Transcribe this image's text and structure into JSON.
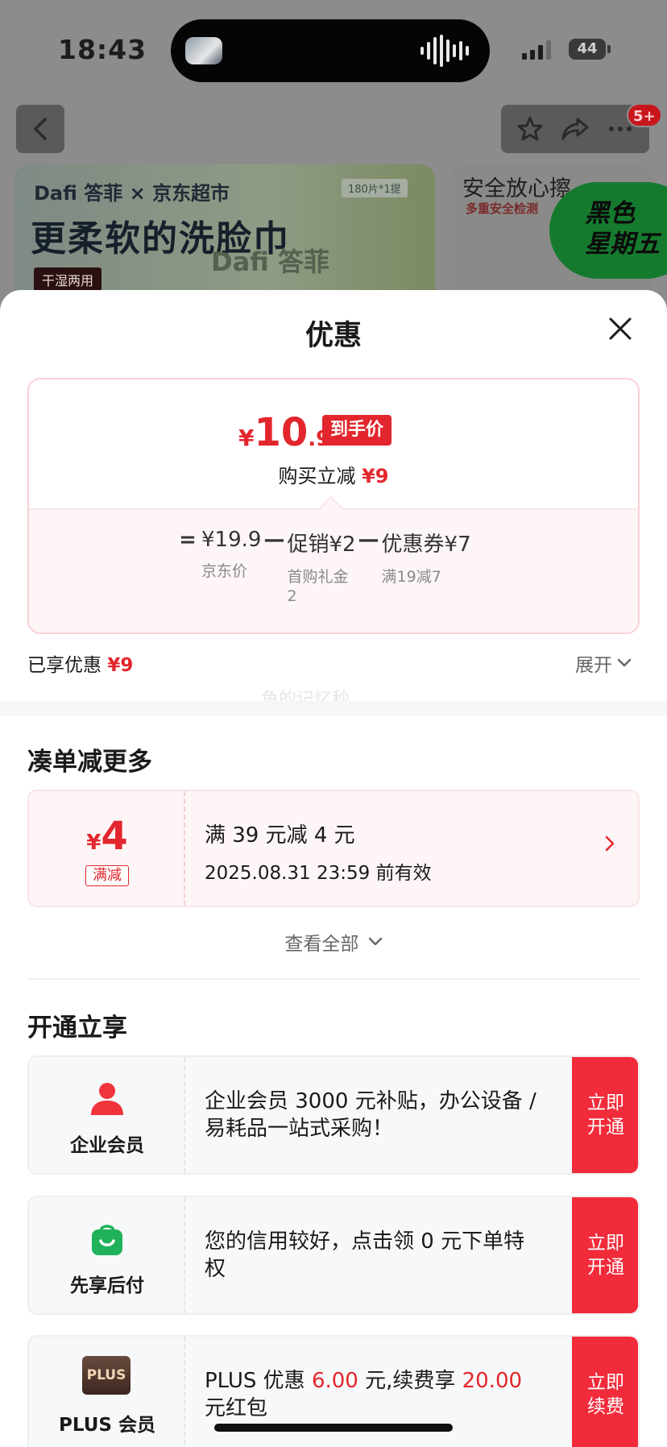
{
  "status_bar": {
    "time": "18:43",
    "battery": "44"
  },
  "background": {
    "badge": "5+",
    "banner_left": {
      "brand": "Dafi 答菲 × 京东超市",
      "title": "更柔软的洗脸巾",
      "tag": "干湿两用",
      "pack_chip": "180片*1提",
      "pack_brand": "Dafi 答菲"
    },
    "banner_right": {
      "title": "安全放心擦",
      "subtitle": "多重安全检测",
      "promo": "黑色\n星期五"
    }
  },
  "sheet": {
    "title": "优惠",
    "price_card": {
      "currency": "¥",
      "price_int": "10",
      "price_dec": ".9",
      "price_tag": "到手价",
      "instant_label": "购买立减",
      "instant_amount": "¥9",
      "formula": {
        "eq": "=",
        "minus": "—",
        "items": [
          {
            "value": "¥19.9",
            "label": "京东价"
          },
          {
            "value": "促销¥2",
            "label": "首购礼金\n2"
          },
          {
            "value": "优惠券¥7",
            "label": "满19减7"
          }
        ]
      }
    },
    "enjoyed": {
      "label": "已享优惠",
      "amount": "¥9"
    },
    "expand_label": "展开",
    "watermark": "鱼的记忆秒",
    "more_section": {
      "title": "凑单减更多",
      "coupon": {
        "currency": "¥",
        "amount": "4",
        "type": "满减",
        "rule": "满 39 元减 4 元",
        "validity": "2025.08.31 23:59 前有效"
      },
      "view_all": "查看全部"
    },
    "open_section": {
      "title": "开通立享",
      "offers": [
        {
          "name": "企业会员",
          "icon": "person-icon",
          "desc": "企业会员 3000 元补贴，办公设备 / 易耗品一站式采购！",
          "button": "立即开通"
        },
        {
          "name": "先享后付",
          "icon": "shopping-bag-icon",
          "desc": "您的信用较好，点击领 0 元下单特权",
          "button": "立即开通"
        },
        {
          "name": "PLUS 会员",
          "icon": "plus-logo",
          "logo_text": "PLUS",
          "desc_parts": [
            "PLUS 优惠 ",
            "6.00",
            " 元,续费享 ",
            "20.00",
            " 元红包"
          ],
          "button": "立即续费"
        }
      ]
    }
  },
  "colors": {
    "accent": "#e3262d",
    "button": "#f22b3b",
    "coupon_bg": "#fdf5f6"
  }
}
